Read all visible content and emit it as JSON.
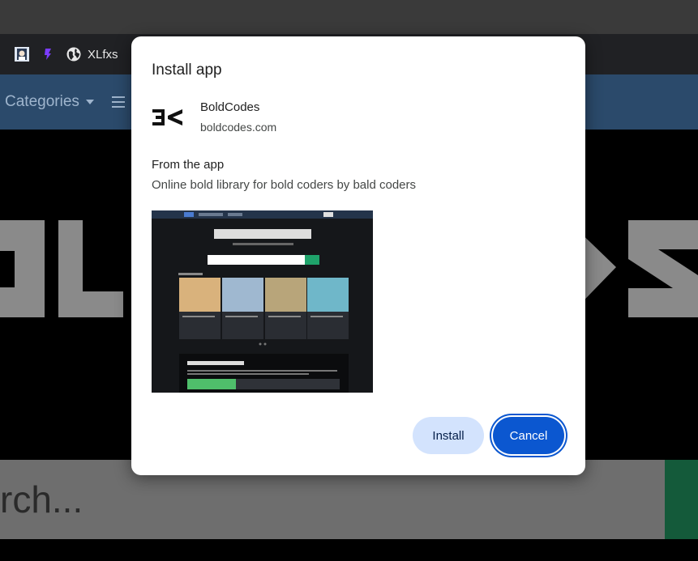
{
  "bookmarks": {
    "items": [
      {
        "icon": "avatar-favicon"
      },
      {
        "icon": "purple-favicon"
      },
      {
        "icon": "globe-icon",
        "label": "XLfxs"
      }
    ]
  },
  "background_page": {
    "nav": {
      "categories_label": "Categories"
    },
    "search_placeholder": "rch..."
  },
  "dialog": {
    "title": "Install app",
    "app_name": "BoldCodes",
    "app_url": "boldcodes.com",
    "from_label": "From the app",
    "description": "Online bold library for bold coders by bald coders",
    "buttons": {
      "install": "Install",
      "cancel": "Cancel"
    }
  },
  "colors": {
    "primary_button": "#0b57d0",
    "tonal_button": "#d3e3fd",
    "nav_bg": "#2b4a6b",
    "accent_green": "#145a3a"
  }
}
